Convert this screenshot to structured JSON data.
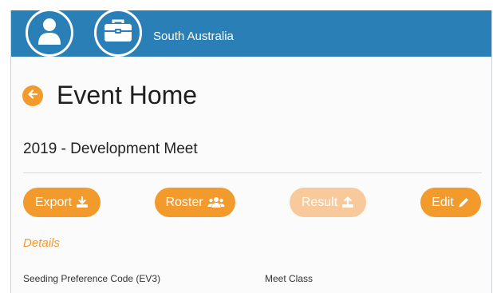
{
  "header": {
    "org_name": "South Australia",
    "colors": {
      "header_bg": "#2a7fb6",
      "accent": "#f39a2c"
    },
    "icons": [
      "user-icon",
      "briefcase-icon"
    ]
  },
  "page": {
    "title": "Event Home",
    "event_name": "2019 - Development Meet"
  },
  "actions": {
    "export_label": "Export",
    "roster_label": "Roster",
    "result_label": "Result",
    "edit_label": "Edit"
  },
  "details": {
    "heading": "Details",
    "fields": [
      {
        "label": "Seeding Preference Code (EV3)"
      },
      {
        "label": "Meet Class"
      }
    ]
  }
}
